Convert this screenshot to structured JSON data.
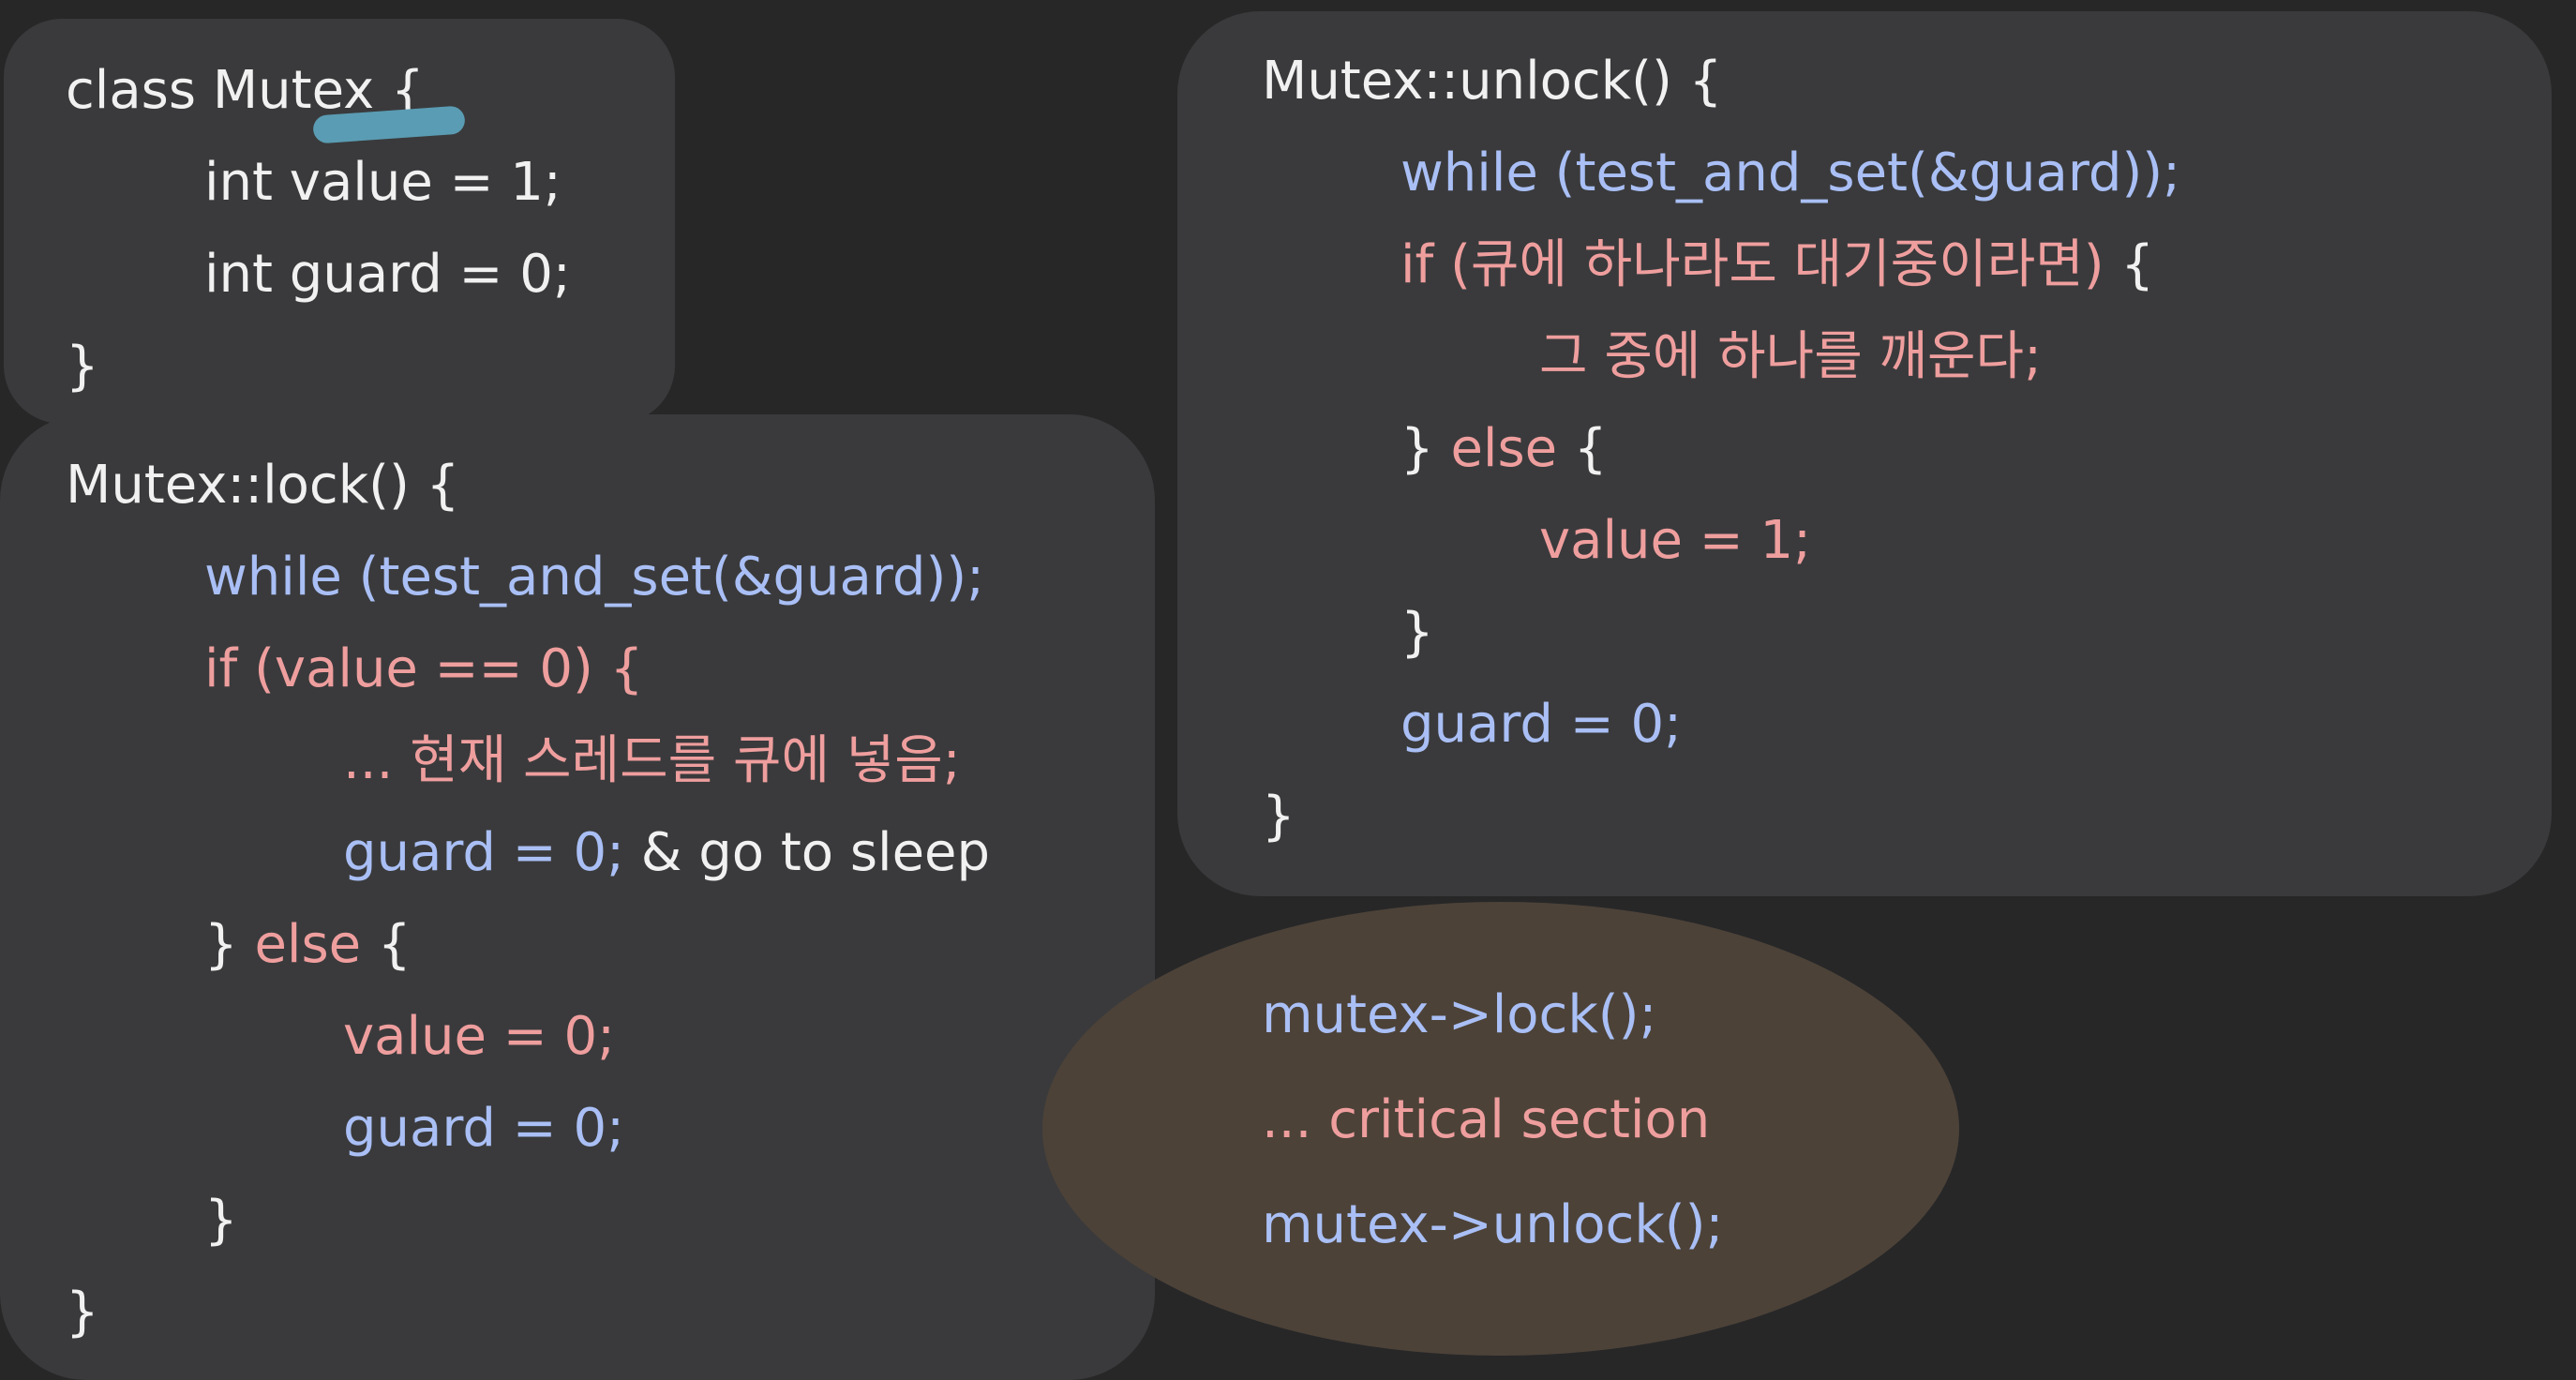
{
  "class_block": {
    "line1": "class Mutex {",
    "line2": "int value = 1;",
    "line3": "int guard = 0;",
    "line4": "}"
  },
  "lock_block": {
    "line1": "Mutex::lock() {",
    "line2": "while (test_and_set(&guard));",
    "line3": "if (value == 0) {",
    "line4": "... 현재 스레드를 큐에 넣음;",
    "line5_code": "guard = 0;",
    "line5_note": " & go to sleep",
    "line6_brace": "} ",
    "line6_else": "else",
    "line6_open": " {",
    "line7": "value = 0;",
    "line8": "guard = 0;",
    "line9": "}",
    "line10": "}"
  },
  "unlock_block": {
    "line1": "Mutex::unlock() {",
    "line2": "while (test_and_set(&guard));",
    "line3_if": "if (큐에 하나라도 대기중이라면)",
    "line3_open": " {",
    "line4": "그 중에 하나를 깨운다;",
    "line5_brace": "} ",
    "line5_else": "else",
    "line5_open": " {",
    "line6": "value = 1;",
    "line7": "}",
    "line8": "guard = 0;",
    "line9": "}"
  },
  "usage_block": {
    "line1": "mutex->lock();",
    "line2": "... critical section",
    "line3": "mutex->unlock();"
  },
  "colors": {
    "background": "#272728",
    "panel": "#3a3a3c",
    "ellipse": "#4c4238",
    "text_white": "#f1f1f1",
    "text_blue": "#a9bff5",
    "text_pink": "#ef9e9e",
    "annotation": "#5a9cb3"
  }
}
